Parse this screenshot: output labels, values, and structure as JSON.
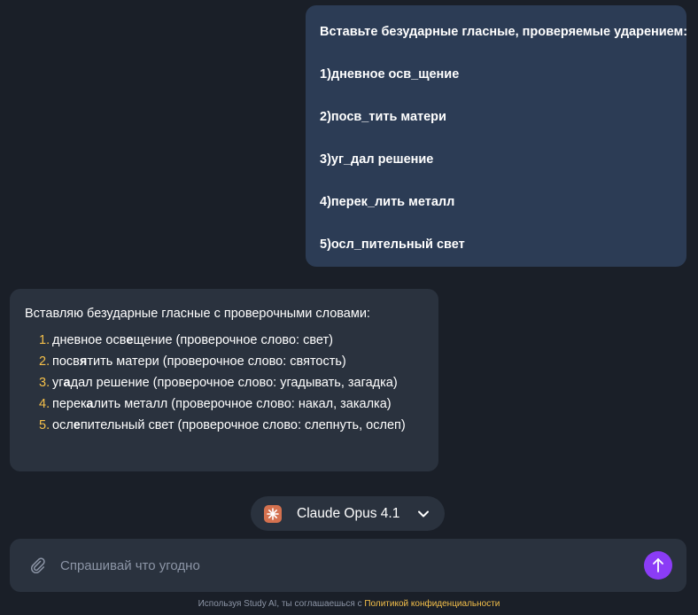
{
  "user_message": {
    "lines": [
      "Вставьте безударные гласные, проверяемые ударением:",
      "1)дневное осв_щение",
      "2)посв_тить матери",
      "3)уг_дал решение",
      "4)перек_лить металл",
      "5)осл_пительный свет"
    ]
  },
  "ai_message": {
    "intro": "Вставляю безударные гласные с проверочными словами:",
    "items": [
      {
        "num": "1.",
        "pre": "дневное осв",
        "hl": "е",
        "post": "щение (проверочное слово: свет)"
      },
      {
        "num": "2.",
        "pre": "посв",
        "hl": "я",
        "post": "тить матери (проверочное слово: святость)"
      },
      {
        "num": "3.",
        "pre": "уг",
        "hl": "а",
        "post": "дал решение (проверочное слово: угадывать, загадка)"
      },
      {
        "num": "4.",
        "pre": "перек",
        "hl": "а",
        "post": "лить металл (проверочное слово: накал, закалка)"
      },
      {
        "num": "5.",
        "pre": "осл",
        "hl": "е",
        "post": "пительный свет (проверочное слово: слепнуть, ослеп)"
      }
    ]
  },
  "model_selector": {
    "label": "Claude Opus 4.1",
    "icon": "claude-spark-icon",
    "icon_color": "#d4714f"
  },
  "composer": {
    "placeholder": "Спрашивай что угодно",
    "attach_icon": "paperclip-icon",
    "send_icon": "arrow-up-icon",
    "send_color": "#8b3cf6"
  },
  "footer": {
    "text": "Используя Study AI, ты соглашаешься с",
    "link": "Политикой конфиденциальности"
  },
  "colors": {
    "background": "#1a1f28",
    "user_bubble": "#2c3c55",
    "ai_bubble": "#2a323e",
    "accent": "#f5c04a"
  }
}
